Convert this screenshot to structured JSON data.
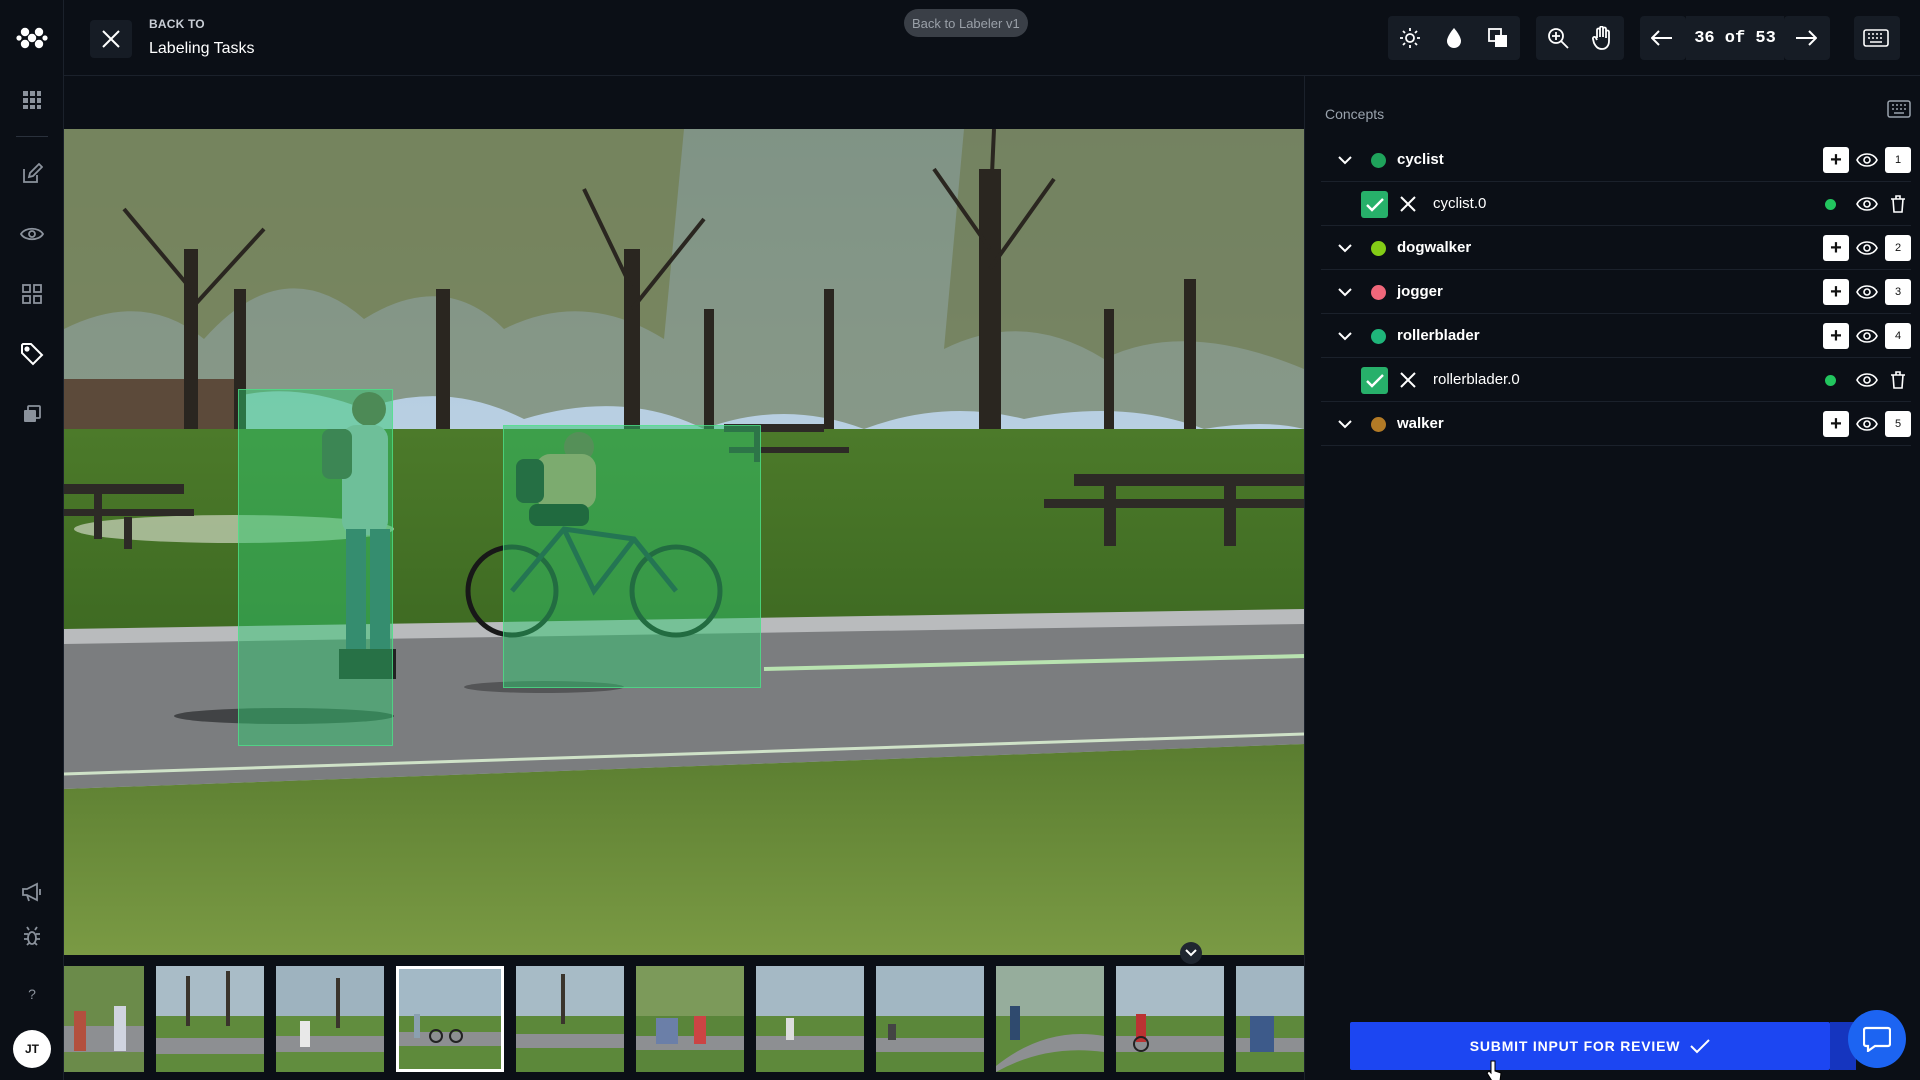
{
  "nav": {
    "back_to_label": "BACK TO",
    "back_to_title": "Labeling Tasks",
    "legacy_pill": "Back to Labeler v1",
    "counter": "36 of 53",
    "rail_icons": [
      "logo-icon",
      "apps-grid-icon",
      "edit-icon",
      "eye-icon",
      "modules-icon",
      "tag-icon",
      "copy-icon",
      "megaphone-icon",
      "bug-icon",
      "help-icon"
    ],
    "help_glyph": "?",
    "avatar_initials": "JT"
  },
  "toolbar": {
    "icons": [
      "brightness-icon",
      "contrast-icon",
      "overlay-icon",
      "zoom-in-icon",
      "pan-hand-icon",
      "arrow-left-icon",
      "arrow-right-icon",
      "keyboard-icon"
    ]
  },
  "annotations": [
    {
      "concept": "rollerblader",
      "color": "#2ec86e"
    },
    {
      "concept": "cyclist",
      "color": "#2ec86e"
    }
  ],
  "concepts_panel": {
    "title": "Concepts",
    "concepts": [
      {
        "name": "cyclist",
        "color": "#1fa35b",
        "key": "1",
        "instances": [
          {
            "name": "cyclist.0"
          }
        ]
      },
      {
        "name": "dogwalker",
        "color": "#84cc16",
        "key": "2",
        "instances": []
      },
      {
        "name": "jogger",
        "color": "#f0677a",
        "key": "3",
        "instances": []
      },
      {
        "name": "rollerblader",
        "color": "#1fb57a",
        "key": "4",
        "instances": [
          {
            "name": "rollerblader.0"
          }
        ]
      },
      {
        "name": "walker",
        "color": "#b27a26",
        "key": "5",
        "instances": []
      }
    ]
  },
  "filmstrip": {
    "thumb_count": 11,
    "active_index": 3
  },
  "footer": {
    "submit_label": "SUBMIT INPUT FOR REVIEW"
  },
  "colors": {
    "primary": "#1c46f2",
    "annotation_fill": "#2ec86e",
    "check": "#27b06a"
  }
}
